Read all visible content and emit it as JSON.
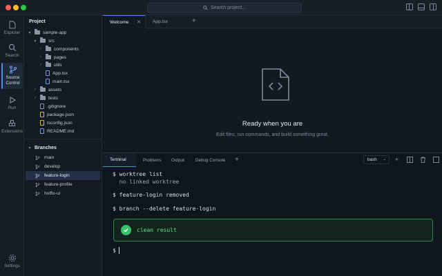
{
  "titlebar": {
    "search_placeholder": "Search project...",
    "icons": [
      "toggle-left-panel-icon",
      "toggle-bottom-panel-icon",
      "toggle-right-panel-icon"
    ]
  },
  "activity": {
    "items": [
      {
        "label": "Explorer",
        "icon": "files-icon"
      },
      {
        "label": "Search",
        "icon": "search-icon"
      },
      {
        "label": "Source Control",
        "icon": "branch-icon"
      },
      {
        "label": "Run",
        "icon": "play-icon"
      },
      {
        "label": "Extensions",
        "icon": "extensions-icon"
      }
    ],
    "settings_label": "Settings"
  },
  "sidebar": {
    "project_title": "Project",
    "tree": [
      {
        "label": "sample-app",
        "type": "folder",
        "expanded": true
      },
      {
        "label": "src",
        "type": "folder",
        "expanded": true
      },
      {
        "label": "components",
        "type": "folder",
        "expanded": false
      },
      {
        "label": "pages",
        "type": "folder",
        "expanded": false
      },
      {
        "label": "utils",
        "type": "folder",
        "expanded": false
      },
      {
        "label": "App.tsx",
        "type": "file"
      },
      {
        "label": "main.tsx",
        "type": "file"
      },
      {
        "label": "assets",
        "type": "folder",
        "expanded": false
      },
      {
        "label": "tests",
        "type": "folder",
        "expanded": false
      },
      {
        "label": ".gitignore",
        "type": "file"
      },
      {
        "label": "package.json",
        "type": "file"
      },
      {
        "label": "tsconfig.json",
        "type": "file"
      },
      {
        "label": "README.md",
        "type": "file"
      }
    ],
    "branches_title": "Branches",
    "branches": [
      "main",
      "develop",
      "feature-login",
      "feature-profile",
      "hotfix-ui"
    ],
    "active_branch": "feature-login"
  },
  "editor": {
    "tabs": [
      {
        "label": "Welcome",
        "active": true
      },
      {
        "label": "App.tsx",
        "active": false
      }
    ],
    "welcome_title": "Ready when you are",
    "welcome_subtitle": "Edit files, run commands, and build something great."
  },
  "terminal": {
    "tabs": [
      "Terminal",
      "Problems",
      "Output",
      "Debug Console"
    ],
    "shell": "bash",
    "lines": [
      {
        "text": "$ worktree list",
        "dim": false
      },
      {
        "text": "  no linked worktree",
        "dim": true
      },
      {
        "text": "$ feature-login removed",
        "dim": false
      },
      {
        "text": "$ branch --delete feature-login",
        "dim": false
      }
    ],
    "result": "clean result",
    "prompt": "$"
  },
  "colors": {
    "accent": "#4b8ef0",
    "success": "#37c26b",
    "background": "#111821"
  }
}
